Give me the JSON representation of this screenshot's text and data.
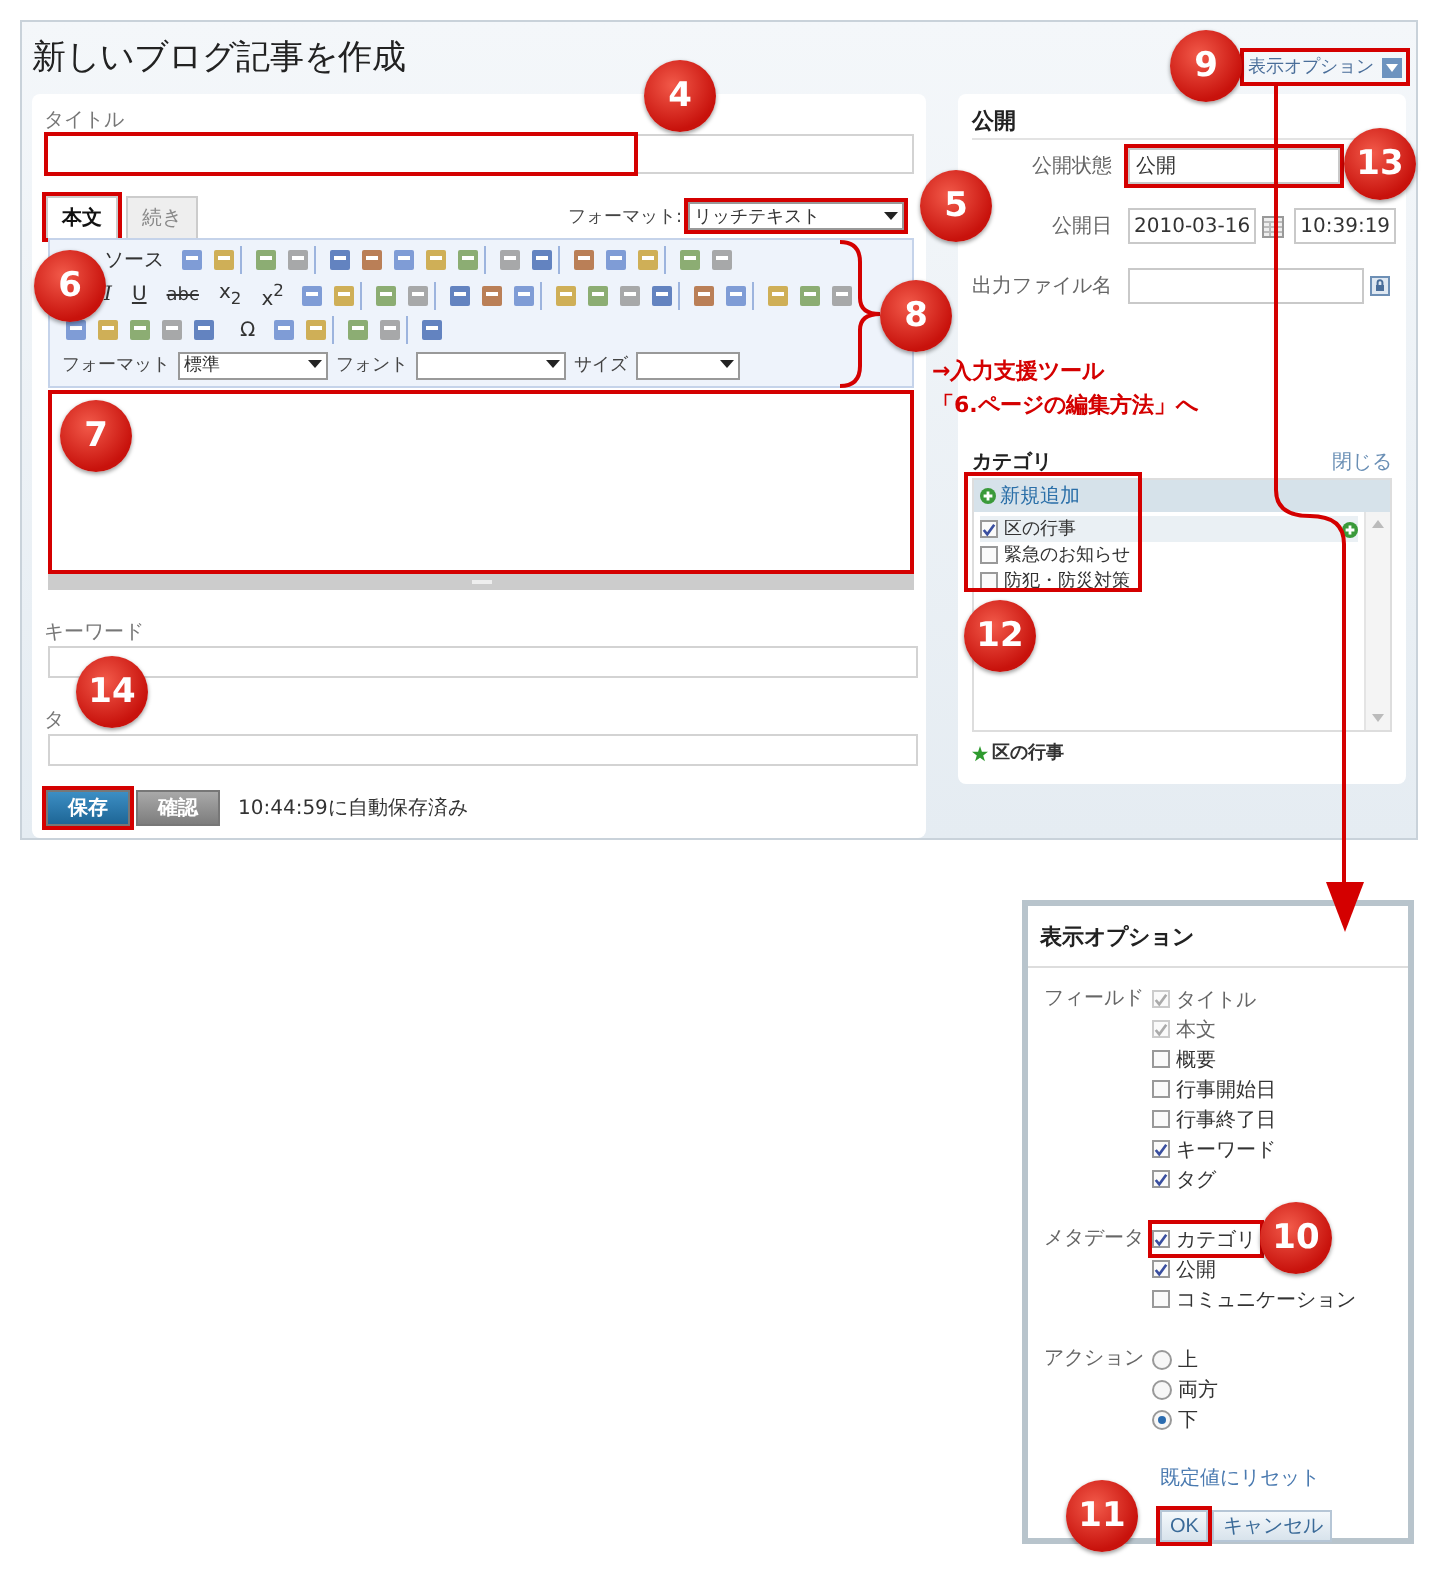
{
  "page_title": "新しいブログ記事を作成",
  "display_options_link": {
    "label": "表示オプション",
    "highlighted": true,
    "callout": "9"
  },
  "title_field": {
    "label": "タイトル",
    "highlighted": true,
    "callout": "4"
  },
  "editor_tabs": [
    {
      "label": "本文",
      "selected": true,
      "highlighted": true,
      "callout": "6"
    },
    {
      "label": "続き",
      "selected": false,
      "highlighted": false
    }
  ],
  "format": {
    "label": "フォーマット:",
    "value": "リッチテキスト",
    "highlighted": true,
    "callout": "5"
  },
  "toolbar": {
    "source": "ソース",
    "glyph_buttons": [
      "I",
      "U",
      "abc",
      "x$_{2}$",
      "x$^{2}$"
    ],
    "symbol_button": "Ω",
    "format_label": "フォーマット",
    "format_value": "標準",
    "font_label": "フォント",
    "size_label": "サイズ",
    "callout": "8"
  },
  "editor_area": {
    "highlighted": true,
    "callout": "7"
  },
  "keyword_field": {
    "label": "キーワード"
  },
  "tag_field": {
    "label": "タ"
  },
  "buttons": [
    {
      "label": "保存",
      "kind": "primary",
      "highlighted": true,
      "callout": "14"
    },
    {
      "label": "確認",
      "kind": "secondary",
      "highlighted": false
    }
  ],
  "autosave": "10:44:59に自動保存済み",
  "publish": {
    "heading": "公開",
    "status_label": "公開状態",
    "status_value": "公開",
    "status_highlighted": true,
    "status_callout": "13",
    "date_label": "公開日",
    "date": "2010-03-16",
    "time": "10:39:19",
    "filename_label": "出力ファイル名"
  },
  "note": [
    "→入力支援ツール",
    "「6.ページの編集方法」へ"
  ],
  "category": {
    "heading": "カテゴリ",
    "close": "閉じる",
    "add": "新規追加",
    "highlighted": true,
    "callout": "12",
    "items": [
      {
        "label": "区の行事",
        "checked": true
      },
      {
        "label": "緊急のお知らせ",
        "checked": false
      },
      {
        "label": "防犯・防災対策",
        "checked": false
      }
    ],
    "selected_tags": [
      "区の行事"
    ]
  },
  "options_popup": {
    "title": "表示オプション",
    "groups": [
      {
        "label": "フィールド",
        "kind": "checkbox",
        "items": [
          {
            "label": "タイトル",
            "checked": true,
            "disabled": true,
            "highlighted": false
          },
          {
            "label": "本文",
            "checked": true,
            "disabled": true,
            "highlighted": false
          },
          {
            "label": "概要",
            "checked": false,
            "disabled": false,
            "highlighted": false
          },
          {
            "label": "行事開始日",
            "checked": false,
            "disabled": false,
            "highlighted": false
          },
          {
            "label": "行事終了日",
            "checked": false,
            "disabled": false,
            "highlighted": false
          },
          {
            "label": "キーワード",
            "checked": true,
            "disabled": false,
            "highlighted": false
          },
          {
            "label": "タグ",
            "checked": true,
            "disabled": false,
            "highlighted": false
          }
        ]
      },
      {
        "label": "メタデータ",
        "kind": "checkbox",
        "items": [
          {
            "label": "カテゴリ",
            "checked": true,
            "disabled": false,
            "highlighted": true,
            "callout": "10"
          },
          {
            "label": "公開",
            "checked": true,
            "disabled": false,
            "highlighted": false
          },
          {
            "label": "コミュニケーション",
            "checked": false,
            "disabled": false,
            "highlighted": false
          }
        ]
      },
      {
        "label": "アクション",
        "kind": "radio",
        "items": [
          {
            "label": "上",
            "selected": false
          },
          {
            "label": "両方",
            "selected": false
          },
          {
            "label": "下",
            "selected": true
          }
        ]
      }
    ],
    "reset": "既定値にリセット",
    "buttons": [
      {
        "label": "OK",
        "highlighted": true,
        "callout": "11"
      },
      {
        "label": "キャンセル",
        "highlighted": false
      }
    ]
  }
}
